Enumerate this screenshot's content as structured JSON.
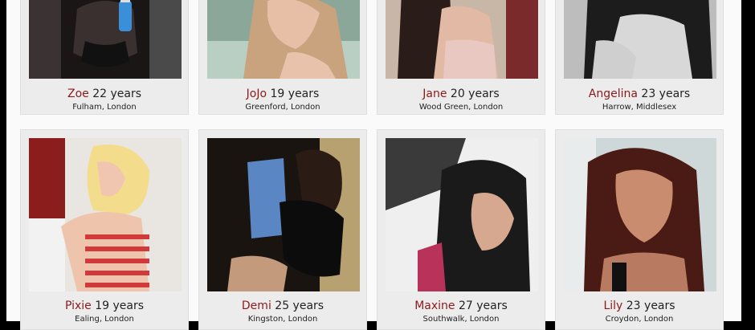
{
  "profiles_row1": [
    {
      "name": "Zoe",
      "age": "22 years",
      "location": "Fulham, London",
      "photo": "photo-dark-lace-bottle"
    },
    {
      "name": "JoJo",
      "age": "19 years",
      "location": "Greenford, London",
      "photo": "photo-blonde-selfie"
    },
    {
      "name": "Jane",
      "age": "20 years",
      "location": "Wood Green, London",
      "photo": "photo-brunette-pink-top"
    },
    {
      "name": "Angelina",
      "age": "23 years",
      "location": "Harrow, Middlesex",
      "photo": "photo-black-and-white"
    }
  ],
  "profiles_row2": [
    {
      "name": "Pixie",
      "age": "19 years",
      "location": "Ealing, London",
      "photo": "photo-blonde-striped-dress"
    },
    {
      "name": "Demi",
      "age": "25 years",
      "location": "Kingston, London",
      "photo": "photo-black-dress-party"
    },
    {
      "name": "Maxine",
      "age": "27 years",
      "location": "Southwalk, London",
      "photo": "photo-selfie-dark-hair"
    },
    {
      "name": "Lily",
      "age": "23 years",
      "location": "Croydon, London",
      "photo": "photo-auburn-hair-portrait"
    }
  ],
  "colors": {
    "name_accent": "#8b1a1a",
    "card_bg": "#ececec",
    "page_bg": "#fafafa",
    "frame_bg": "#000000"
  }
}
